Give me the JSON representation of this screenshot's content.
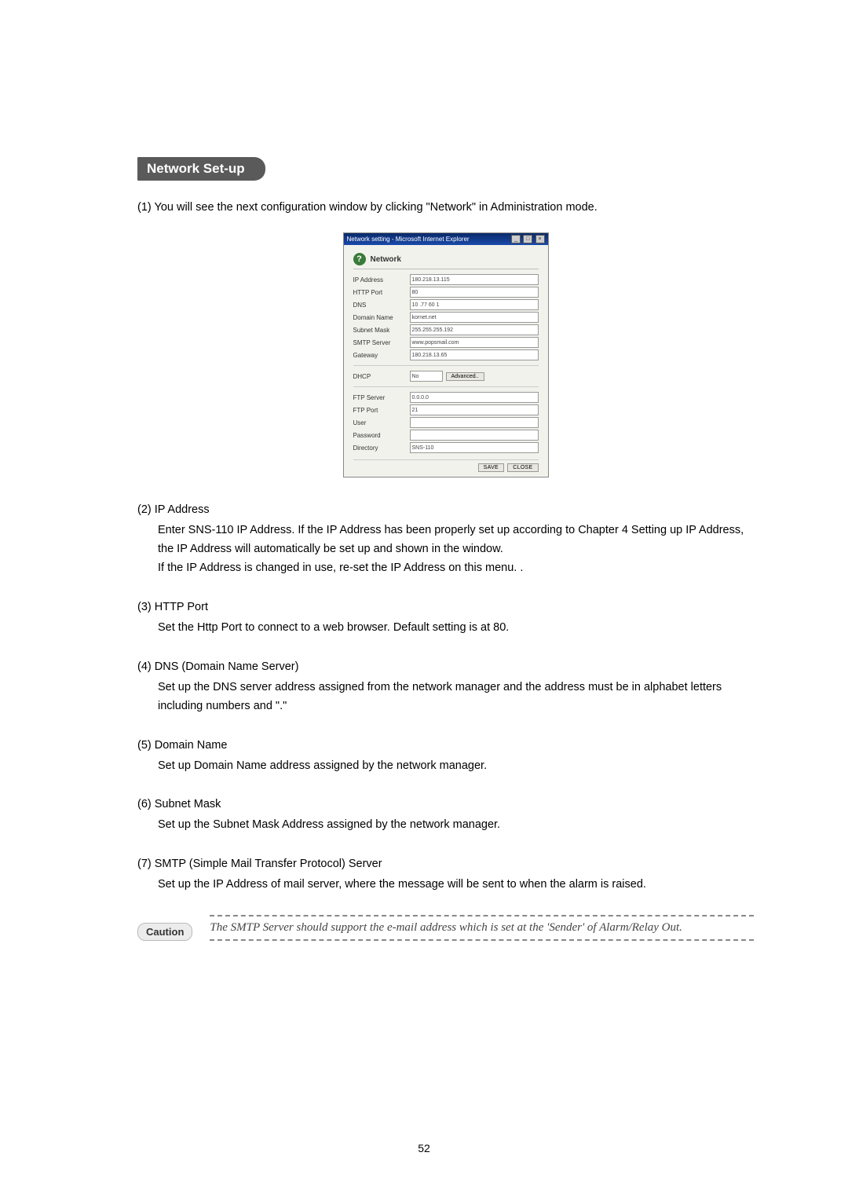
{
  "heading": "Network Set-up",
  "intro": "(1)  You will see the next configuration window by clicking \"Network\" in Administration mode.",
  "window": {
    "title": "Network setting - Microsoft Internet Explorer",
    "panel_title": "Network",
    "fields1": [
      {
        "label": "IP Address",
        "value": "180.218.13.115"
      },
      {
        "label": "HTTP Port",
        "value": "80"
      },
      {
        "label": "DNS",
        "value": "10 .77 60 1"
      },
      {
        "label": "Domain Name",
        "value": "kornet.net"
      },
      {
        "label": "Subnet Mask",
        "value": "255.255.255.192"
      },
      {
        "label": "SMTP Server",
        "value": "www.popsmail.com"
      },
      {
        "label": "Gateway",
        "value": "180.218.13.65"
      }
    ],
    "dhcp": {
      "label": "DHCP",
      "value": "No",
      "btn": "Advanced.."
    },
    "fields2": [
      {
        "label": "FTP Server",
        "value": "0.0.0.0"
      },
      {
        "label": "FTP Port",
        "value": "21"
      },
      {
        "label": "User",
        "value": ""
      },
      {
        "label": "Password",
        "value": ""
      },
      {
        "label": "Directory",
        "value": "SNS-110"
      }
    ],
    "save": "SAVE",
    "close": "CLOSE"
  },
  "sections": [
    {
      "head": "(2)  IP Address",
      "body": "Enter SNS-110 IP Address.  If the IP Address has been properly set up according to Chapter 4 Setting up IP Address, the IP Address will automatically be set up and shown in the window.\nIf the IP Address is changed in use, re-set the IP Address on this menu. ."
    },
    {
      "head": "(3)  HTTP Port",
      "body": "Set the Http Port to connect to a web browser. Default setting is at 80."
    },
    {
      "head": "(4)  DNS (Domain Name Server)",
      "body": "Set up the DNS server address assigned from the network manager and the address must be in alphabet letters including numbers and \".\""
    },
    {
      "head": "(5)  Domain Name",
      "body": "Set up Domain Name address assigned by the network manager."
    },
    {
      "head": "(6)  Subnet Mask",
      "body": "Set up the Subnet Mask Address assigned by the network manager."
    },
    {
      "head": "(7)  SMTP (Simple Mail Transfer Protocol) Server",
      "body": "Set up the IP Address of mail server, where the message will be sent to when the alarm is raised."
    }
  ],
  "caution": {
    "label": "Caution",
    "text": "The SMTP Server should support the e-mail address which is set at the 'Sender' of Alarm/Relay Out."
  },
  "pagenum": "52"
}
